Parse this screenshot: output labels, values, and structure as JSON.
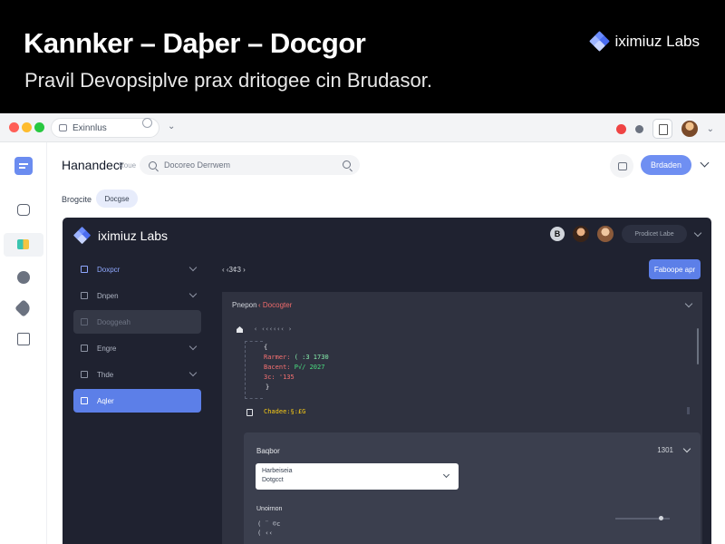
{
  "banner": {
    "title": "Kannker – Daþer – Docgor",
    "subtitle": "Pravil Devopsiplve prax dritogee cin Brudasor.",
    "brand": "iximiuz Labs"
  },
  "browser": {
    "tab_title": "Exinnlus"
  },
  "app": {
    "title": "Hanandecr",
    "title_tag": "Roue",
    "search_placeholder": "Docoreo Derrwem",
    "primary_button": "Brdaden",
    "breadcrumb": "Brogcite",
    "breadcrumb_pill": "Docgse"
  },
  "embedded": {
    "brand": "iximiuz Labs",
    "avatar_letter": "B",
    "plan_label": "Prodicet Labe",
    "nav": [
      {
        "label": "Doxpcr"
      },
      {
        "label": "Dnpen"
      },
      {
        "label": "Dooggeah"
      },
      {
        "label": "Engre"
      },
      {
        "label": "Thde"
      },
      {
        "label": "Aqler"
      }
    ],
    "back_link": "‹ ‹3¢3 ›",
    "cta_button": "Faboope apr",
    "panel": {
      "title": "Pnepon",
      "crumb": "‹ Docogter",
      "path": "‹ ‹‹‹‹‹‹ ›",
      "code_open": "{",
      "code_lines": [
        {
          "key": "Rarmer:",
          "val": "( :3 1730",
          "key_color": "red",
          "val_color": "green"
        },
        {
          "key": "Bacent:",
          "val": "P√/ 2027",
          "key_color": "red",
          "val_color": "green"
        },
        {
          "key": "3c:",
          "val": "'135",
          "key_color": "red",
          "val_color": "red"
        }
      ],
      "code_close": "}",
      "file": "Chadee:§:£G"
    },
    "sub_panel": {
      "title": "Baqbor",
      "count": "1301",
      "select_line1": "Harbeiseia",
      "select_line2": "Dotgcct",
      "label": "Unoirnon",
      "code_line1": "( ¨   ©c",
      "code_line2": "   ( ‹‹"
    }
  },
  "colors": {
    "accent": "#6f8ff2",
    "dark_bg": "#1f2230",
    "nav_selected": "#5c7fe8"
  }
}
